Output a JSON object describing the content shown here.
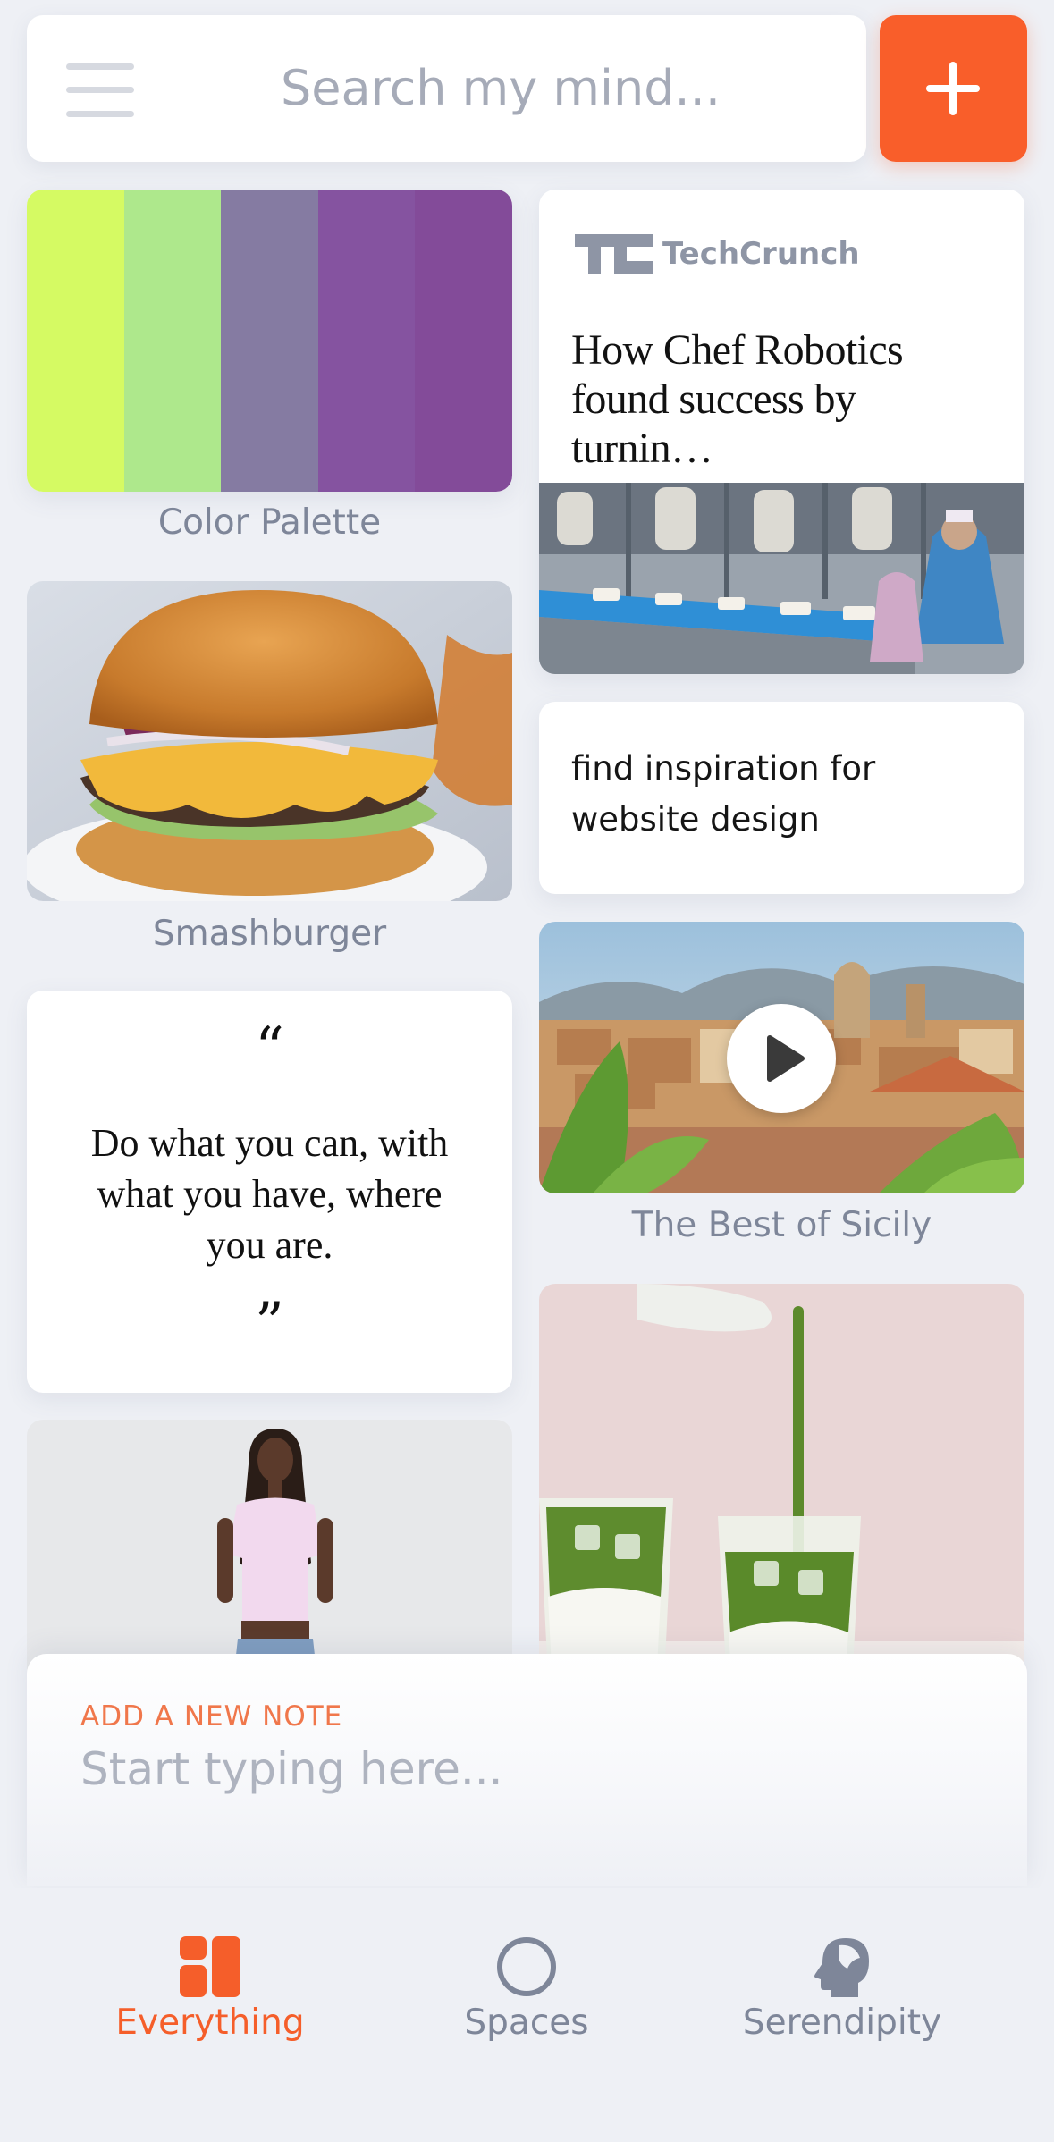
{
  "search": {
    "placeholder": "Search my mind..."
  },
  "palette": {
    "caption": "Color Palette",
    "colors": [
      "#d5fa63",
      "#aee88c",
      "#857ba2",
      "#8553a0",
      "#834b99"
    ]
  },
  "burger": {
    "caption": "Smashburger"
  },
  "quote": {
    "open_mark": "“",
    "text": "Do what you can, with what you have, where you are.",
    "close_mark": "”"
  },
  "techcrunch": {
    "brand": "TechCrunch",
    "headline": "How Chef Robotics found success by turnin…"
  },
  "note": {
    "text": "find inspiration for website design"
  },
  "sicily": {
    "caption": "The Best of Sicily"
  },
  "new_note": {
    "label": "ADD A NEW NOTE",
    "placeholder": "Start typing here..."
  },
  "nav": {
    "items": [
      {
        "label": "Everything",
        "icon": "grid-icon",
        "active": true
      },
      {
        "label": "Spaces",
        "icon": "circle-icon",
        "active": false
      },
      {
        "label": "Serendipity",
        "icon": "head-icon",
        "active": false
      }
    ],
    "active_color": "#f55e2a",
    "inactive_color": "#7e8699"
  },
  "colors": {
    "accent": "#f95e2a",
    "background": "#eef0f5"
  }
}
